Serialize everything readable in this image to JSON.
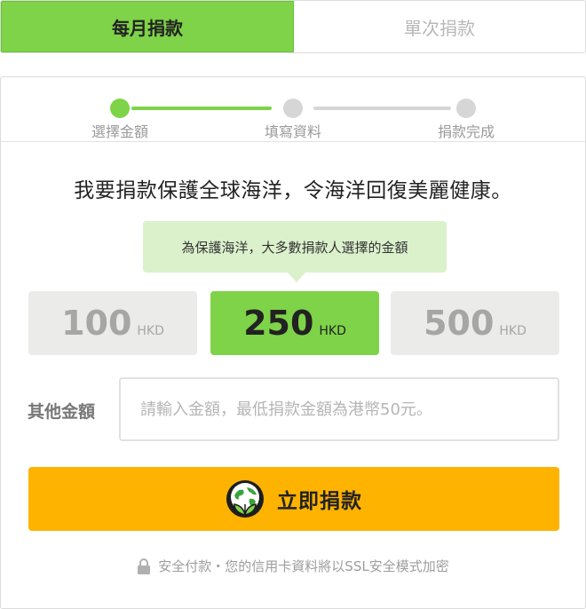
{
  "tabs": [
    {
      "label": "每月捐款",
      "active": true
    },
    {
      "label": "單次捐款",
      "active": false
    }
  ],
  "steps": [
    {
      "label": "選擇金額",
      "done": true
    },
    {
      "label": "填寫資料",
      "done": false
    },
    {
      "label": "捐款完成",
      "done": false
    }
  ],
  "headline": "我要捐款保護全球海洋，令海洋回復美麗健康。",
  "tooltip": "為保護海洋，大多數捐款人選擇的金額",
  "amounts": [
    {
      "value": "100",
      "currency": "HKD",
      "selected": false
    },
    {
      "value": "250",
      "currency": "HKD",
      "selected": true
    },
    {
      "value": "500",
      "currency": "HKD",
      "selected": false
    }
  ],
  "other": {
    "label": "其他金額",
    "placeholder": "請輸入金額，最低捐款金額為港幣50元。"
  },
  "donate_button": {
    "label": "立即捐款",
    "icon": "earth-plant-icon"
  },
  "secure_note": {
    "text": "安全付款・您的信用卡資料將以SSL安全模式加密",
    "icon": "lock-icon"
  },
  "colors": {
    "accent": "#7ed348",
    "button": "#feb300",
    "tooltip_bg": "#dbf1cc"
  }
}
